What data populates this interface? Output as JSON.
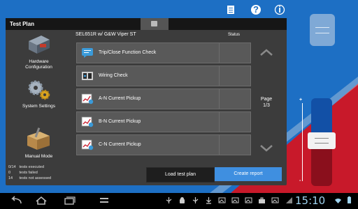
{
  "panel": {
    "title": "Test Plan",
    "device_heading": "SEL651R w/ G&W Viper ST",
    "status_heading": "Status"
  },
  "nav": [
    {
      "label": "Hardware\nConfiguration",
      "icon": "hardware-icon"
    },
    {
      "label": "System Settings",
      "icon": "gears-icon"
    },
    {
      "label": "Manual Mode",
      "icon": "toolbox-icon"
    }
  ],
  "tests": [
    {
      "label": "Trip/Close Function Check",
      "icon": "message-icon"
    },
    {
      "label": "Wiring Check",
      "icon": "wiring-icon"
    },
    {
      "label": "A-N Current Pickup",
      "icon": "pickup-icon"
    },
    {
      "label": "B-N Current Pickup",
      "icon": "pickup-icon"
    },
    {
      "label": "C-N Current Pickup",
      "icon": "pickup-icon"
    }
  ],
  "pagination": {
    "label": "Page",
    "value": "1/3"
  },
  "summary": [
    {
      "count": "0/14",
      "text": "tests executed"
    },
    {
      "count": "0",
      "text": "tests failed"
    },
    {
      "count": "14",
      "text": "tests not assessed"
    }
  ],
  "buttons": {
    "load": "Load test plan",
    "create": "Create report"
  },
  "topbar": {
    "help": "?",
    "info": "i"
  },
  "slider": {
    "plus": "+",
    "minus": "-"
  },
  "statusbar": {
    "clock": "15:10"
  },
  "colors": {
    "background": "#1d6fc4",
    "accent": "#3f8fe0",
    "red": "#c8192a"
  }
}
